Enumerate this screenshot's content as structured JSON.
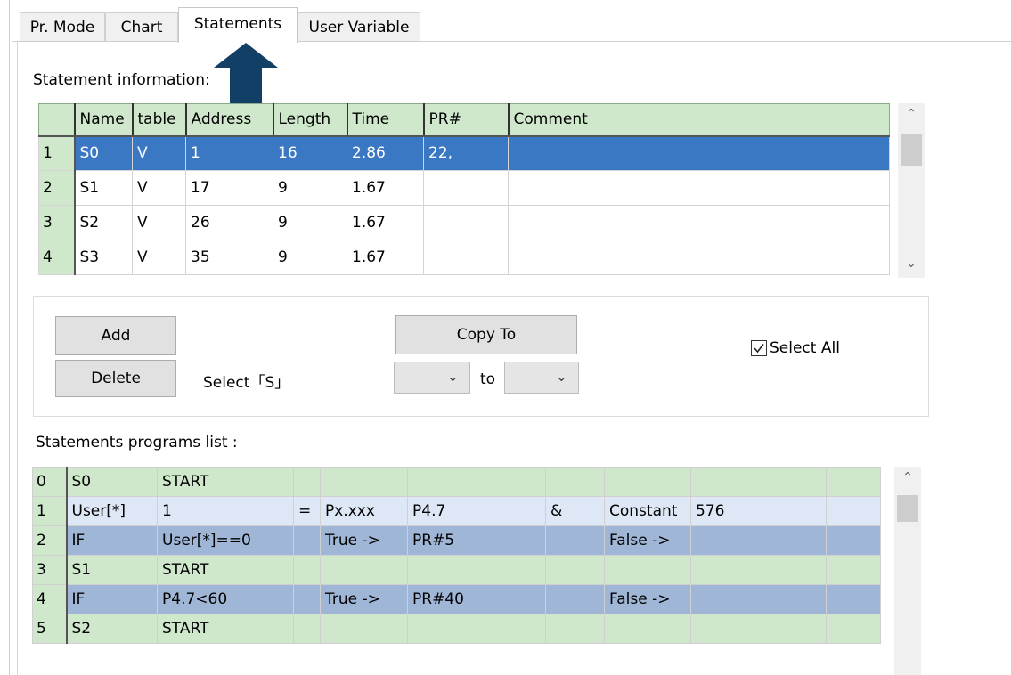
{
  "tabs": [
    "Pr. Mode",
    "Chart",
    "Statements",
    "User Variable"
  ],
  "statement_info_label": "Statement information:",
  "statement_table": {
    "headers": [
      "Name",
      "table",
      "Address",
      "Length",
      "Time",
      "PR#",
      "Comment"
    ],
    "rows": [
      {
        "num": "1",
        "cells": [
          "S0",
          "V",
          "1",
          "16",
          "2.86",
          "22,",
          ""
        ]
      },
      {
        "num": "2",
        "cells": [
          "S1",
          "V",
          "17",
          "9",
          "1.67",
          "",
          ""
        ]
      },
      {
        "num": "3",
        "cells": [
          "S2",
          "V",
          "26",
          "9",
          "1.67",
          "",
          ""
        ]
      },
      {
        "num": "4",
        "cells": [
          "S3",
          "V",
          "35",
          "9",
          "1.67",
          "",
          ""
        ]
      }
    ]
  },
  "buttons": {
    "add": "Add",
    "delete": "Delete",
    "copy_to": "Copy To"
  },
  "select_label": "Select「S」",
  "to_label": "to",
  "select_all": {
    "label": "Select All",
    "checked": true
  },
  "programs_label": "Statements programs list :",
  "program_rows": [
    {
      "num": "0",
      "style": "g",
      "cells": [
        "S0",
        "START",
        "",
        "",
        "",
        "",
        "",
        "",
        ""
      ]
    },
    {
      "num": "1",
      "style": "l",
      "cells": [
        "User[*]",
        "1",
        "=",
        "Px.xxx",
        "P4.7",
        "&",
        "Constant",
        "576",
        ""
      ]
    },
    {
      "num": "2",
      "style": "b",
      "cells": [
        "IF",
        "User[*]==0",
        "",
        "True  ->",
        "PR#5",
        "",
        "False ->",
        "",
        ""
      ]
    },
    {
      "num": "3",
      "style": "g",
      "cells": [
        "S1",
        "START",
        "",
        "",
        "",
        "",
        "",
        "",
        ""
      ]
    },
    {
      "num": "4",
      "style": "b",
      "cells": [
        "IF",
        "P4.7<60",
        "",
        "True  ->",
        "PR#40",
        "",
        "False ->",
        "",
        ""
      ]
    },
    {
      "num": "5",
      "style": "g",
      "cells": [
        "S2",
        "START",
        "",
        "",
        "",
        "",
        "",
        "",
        ""
      ]
    }
  ],
  "colors": {
    "header_green": "#cfe8cc",
    "selected_blue": "#3b78c4",
    "callout_arrow": "#123f66"
  },
  "icons": {
    "scroll_up": "chevron-up-icon",
    "scroll_down": "chevron-down-icon",
    "combo": "chevron-down-icon",
    "checkbox": "checkmark-icon",
    "annotation": "up-arrow-callout-icon"
  }
}
